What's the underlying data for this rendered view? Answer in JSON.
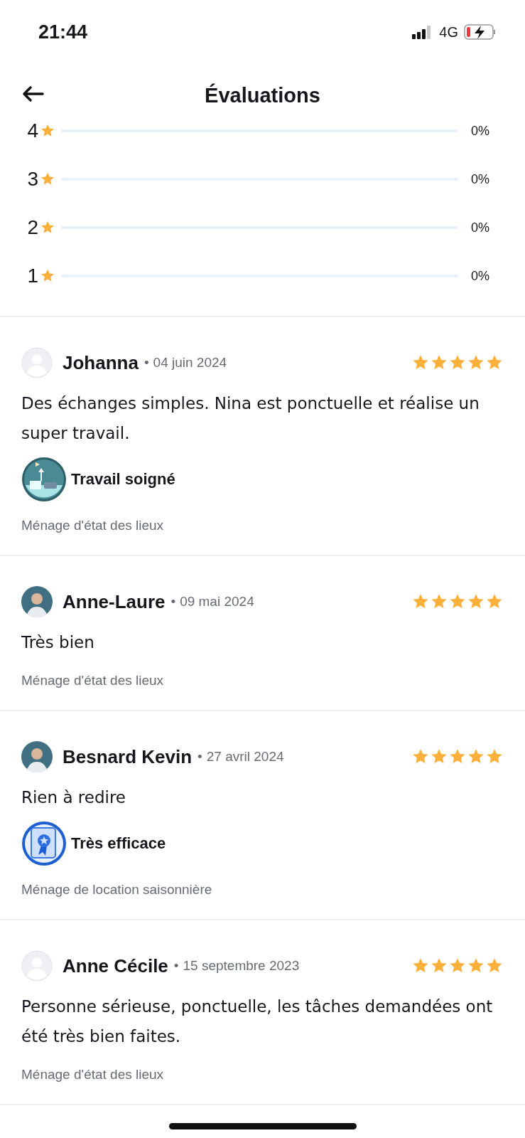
{
  "status_bar": {
    "time": "21:44",
    "network": "4G"
  },
  "header": {
    "title": "Évaluations"
  },
  "breakdown": [
    {
      "label": "4",
      "level": 0,
      "percent": "0%"
    },
    {
      "label": "3",
      "level": 0,
      "percent": "0%"
    },
    {
      "label": "2",
      "level": 0,
      "percent": "0%"
    },
    {
      "label": "1",
      "level": 0,
      "percent": "0%"
    }
  ],
  "reviews": [
    {
      "name": "Johanna",
      "separator": "•",
      "date": "04 juin 2024",
      "photo": false,
      "stars": 5,
      "text": "Des échanges simples. Nina est ponctuelle et réalise un super travail.",
      "badge": {
        "kind": "room",
        "label": "Travail soigné"
      },
      "category": "Ménage d'état des lieux"
    },
    {
      "name": "Anne-Laure",
      "separator": "•",
      "date": "09 mai 2024",
      "photo": true,
      "stars": 5,
      "text": "Très bien",
      "category": "Ménage d'état des lieux"
    },
    {
      "name": "Besnard Kevin",
      "separator": "•",
      "date": "27 avril 2024",
      "photo": true,
      "stars": 5,
      "text": "Rien à redire",
      "badge": {
        "kind": "ribbon",
        "label": "Très efficace"
      },
      "category": "Ménage de location saisonnière"
    },
    {
      "name": "Anne Cécile",
      "separator": "•",
      "date": "15 septembre 2023",
      "photo": false,
      "stars": 5,
      "text": "Personne sérieuse, ponctuelle, les tâches demandées ont été très bien faites.",
      "category": "Ménage d'état des lieux"
    }
  ]
}
